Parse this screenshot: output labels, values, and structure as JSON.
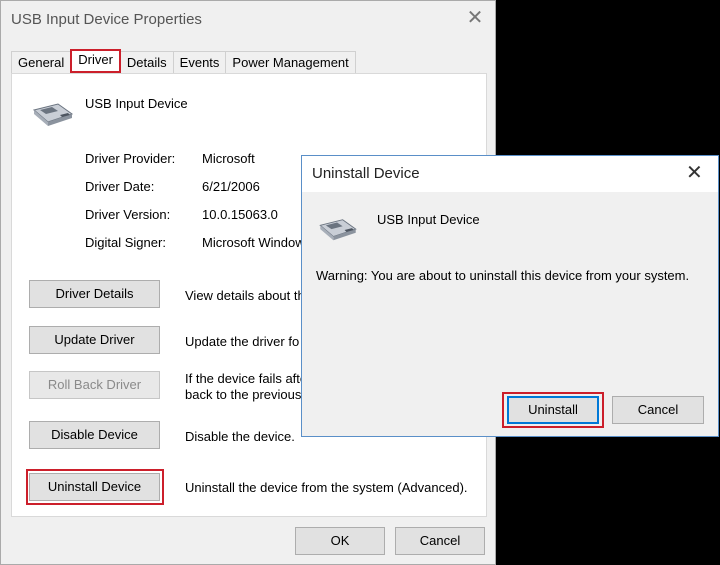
{
  "main_window": {
    "title": "USB Input Device Properties",
    "close_glyph": "✕",
    "tabs": [
      {
        "label": "General",
        "active": false
      },
      {
        "label": "Driver",
        "active": true
      },
      {
        "label": "Details",
        "active": false
      },
      {
        "label": "Events",
        "active": false
      },
      {
        "label": "Power Management",
        "active": false
      }
    ],
    "device_icon": "usb-device-icon",
    "device_name": "USB Input Device",
    "info": {
      "provider_label": "Driver Provider:",
      "provider_value": "Microsoft",
      "date_label": "Driver Date:",
      "date_value": "6/21/2006",
      "version_label": "Driver Version:",
      "version_value": "10.0.15063.0",
      "signer_label": "Digital Signer:",
      "signer_value": "Microsoft Window"
    },
    "actions": {
      "driver_details": {
        "label": "Driver Details",
        "desc": "View details about th"
      },
      "update_driver": {
        "label": "Update Driver",
        "desc": "Update the driver fo"
      },
      "roll_back": {
        "label": "Roll Back Driver",
        "desc_line1": "If the device fails afte",
        "desc_line2": "back to the previous"
      },
      "disable": {
        "label": "Disable Device",
        "desc": "Disable the device."
      },
      "uninstall": {
        "label": "Uninstall Device",
        "desc": "Uninstall the device from the system (Advanced)."
      }
    },
    "ok_label": "OK",
    "cancel_label": "Cancel"
  },
  "dialog": {
    "title": "Uninstall Device",
    "close_glyph": "✕",
    "device_icon": "usb-device-icon",
    "device_name": "USB Input Device",
    "warning": "Warning: You are about to uninstall this device from your system.",
    "uninstall_label": "Uninstall",
    "cancel_label": "Cancel"
  },
  "colors": {
    "highlight_red": "#cc1f2b",
    "focus_blue": "#0078d7",
    "dialog_border": "#5a8fc8"
  }
}
